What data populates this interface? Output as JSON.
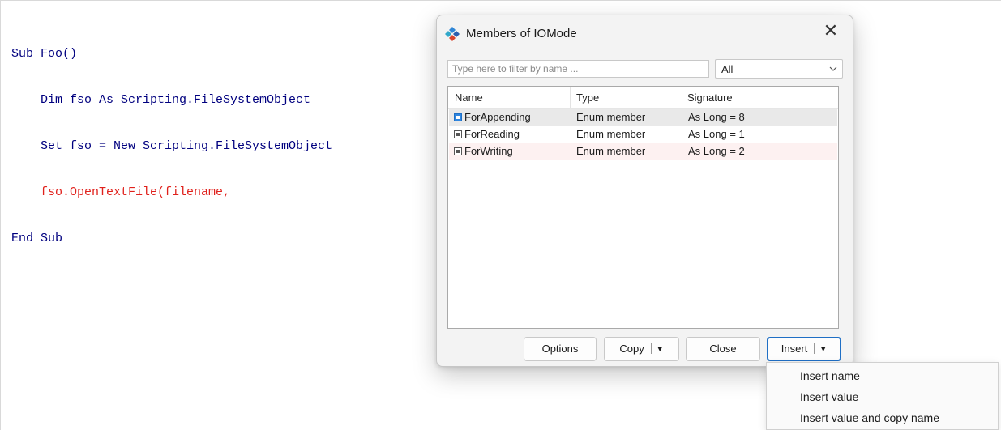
{
  "editor": {
    "lines": [
      {
        "text": "Sub Foo()",
        "style": "normal"
      },
      {
        "text": "    Dim fso As Scripting.FileSystemObject",
        "style": "normal"
      },
      {
        "text": "    Set fso = New Scripting.FileSystemObject",
        "style": "normal"
      },
      {
        "text": "    fso.OpenTextFile(filename,",
        "style": "error"
      },
      {
        "text": "End Sub",
        "style": "normal"
      }
    ]
  },
  "dialog": {
    "title": "Members of IOMode",
    "icon": "app-diamonds-icon",
    "close_glyph": "✕",
    "filter_placeholder": "Type here to filter by name ...",
    "filter_value": "",
    "combo_value": "All",
    "columns": [
      "Name",
      "Type",
      "Signature"
    ],
    "rows": [
      {
        "name": "ForAppending",
        "type": "Enum member",
        "signature": "As Long = 8"
      },
      {
        "name": "ForReading",
        "type": "Enum member",
        "signature": "As Long = 1"
      },
      {
        "name": "ForWriting",
        "type": "Enum member",
        "signature": "As Long = 2"
      }
    ],
    "buttons": {
      "options": "Options",
      "copy": "Copy",
      "close": "Close",
      "insert": "Insert"
    }
  },
  "insert_menu": {
    "items": [
      "Insert name",
      "Insert value",
      "Insert value and copy name"
    ]
  },
  "colors": {
    "code_keyword": "#00007f",
    "code_error": "#e0211c",
    "accent": "#1f6fc5"
  }
}
